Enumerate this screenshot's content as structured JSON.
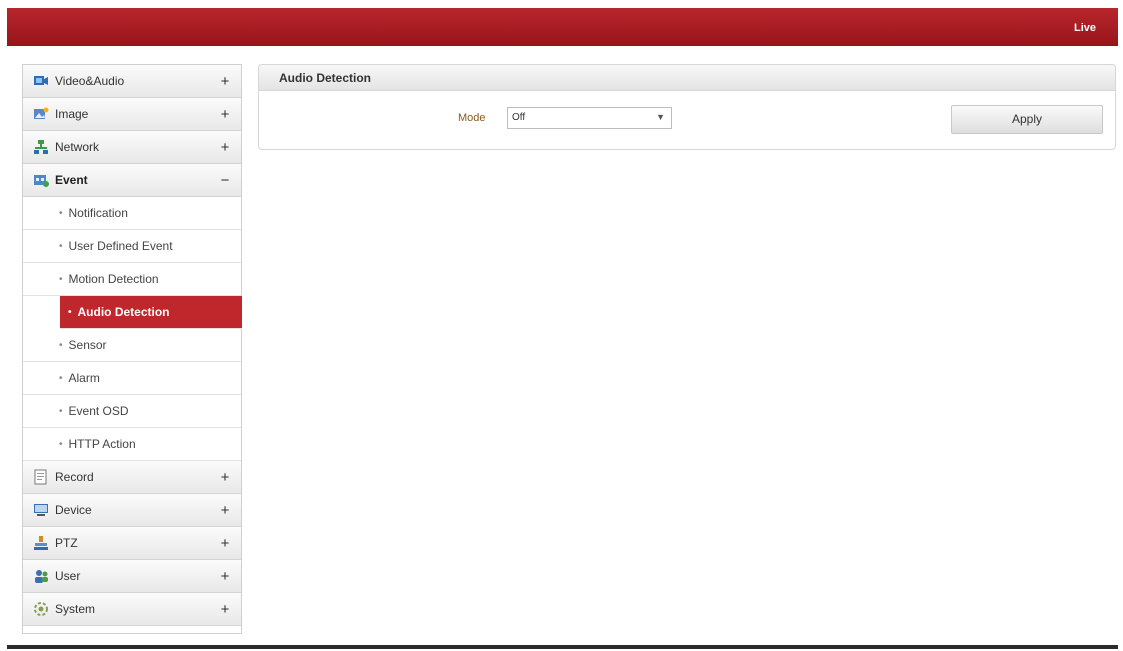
{
  "header": {
    "live_label": "Live",
    "accent_color": "#b01f25"
  },
  "sidebar": {
    "items": [
      {
        "label": "Video&Audio",
        "toggle": "+",
        "icon": "video-audio-icon"
      },
      {
        "label": "Image",
        "toggle": "+",
        "icon": "image-icon"
      },
      {
        "label": "Network",
        "toggle": "+",
        "icon": "network-icon"
      },
      {
        "label": "Event",
        "toggle": "−",
        "icon": "event-icon"
      },
      {
        "label": "Record",
        "toggle": "+",
        "icon": "record-icon"
      },
      {
        "label": "Device",
        "toggle": "+",
        "icon": "device-icon"
      },
      {
        "label": "PTZ",
        "toggle": "+",
        "icon": "ptz-icon"
      },
      {
        "label": "User",
        "toggle": "+",
        "icon": "user-icon"
      },
      {
        "label": "System",
        "toggle": "+",
        "icon": "system-icon"
      }
    ],
    "event_sub": [
      {
        "label": "Notification"
      },
      {
        "label": "User Defined Event"
      },
      {
        "label": "Motion Detection"
      },
      {
        "label": "Audio Detection"
      },
      {
        "label": "Sensor"
      },
      {
        "label": "Alarm"
      },
      {
        "label": "Event OSD"
      },
      {
        "label": "HTTP Action"
      }
    ],
    "bullet": "•"
  },
  "panel": {
    "title": "Audio Detection",
    "mode_label": "Mode",
    "mode_value": "Off",
    "apply_label": "Apply"
  }
}
